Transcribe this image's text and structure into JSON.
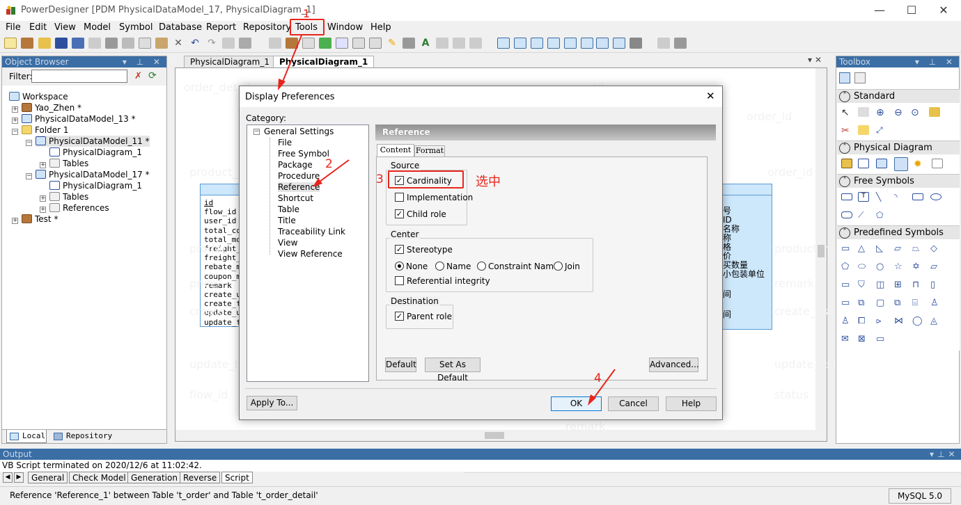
{
  "window": {
    "title": "PowerDesigner [PDM PhysicalDataModel_17, PhysicalDiagram_1]",
    "minimize": "—",
    "maximize": "☐",
    "close": "✕",
    "app_icon": "powerdesigner-icon"
  },
  "menu": [
    "File",
    "Edit",
    "View",
    "Model",
    "Symbol",
    "Database",
    "Report",
    "Repository",
    "Tools",
    "Window",
    "Help"
  ],
  "object_browser": {
    "title": "Object Browser",
    "filter_label": "Filter:",
    "filter_value": "",
    "caption_buttons": "▾ ⊥ ✕",
    "tree": [
      "Workspace",
      "Yao_Zhen *",
      "PhysicalDataModel_13 *",
      "Folder 1",
      "PhysicalDataModel_11 *",
      "PhysicalDiagram_1",
      "Tables",
      "PhysicalDataModel_17 *",
      "PhysicalDiagram_1",
      "Tables",
      "References",
      "Test *"
    ],
    "tabs": [
      "Local",
      "Repository"
    ]
  },
  "doc_tabs": [
    "PhysicalDiagram_1",
    "PhysicalDiagram_1"
  ],
  "canvas": {
    "left_table_columns": [
      "id",
      "flow_id",
      "user_id",
      "total_cou",
      "total_mor",
      "freight_m",
      "freight_v",
      "rebate_mc",
      "coupon_mc",
      "remark",
      "create_us",
      "create_ti",
      "update_us",
      "update_ti"
    ],
    "right_table_items": [
      "号",
      "ID",
      "名称",
      "称",
      "格",
      "价",
      "买数量",
      "小包装单位",
      "间",
      "间"
    ],
    "ghost_texts": [
      "order_detail",
      "status",
      "id",
      "order_id",
      "product_id",
      "order_id",
      "product_id",
      "product_name",
      "price",
      "remark",
      "create_time",
      "create_user",
      "update_time",
      "update_user",
      "flow_id",
      "status",
      "remark"
    ]
  },
  "toolbox": {
    "title": "Toolbox",
    "caption_buttons": "▾ ⊥ ✕",
    "sections": [
      "Standard",
      "Physical Diagram",
      "Free Symbols",
      "Predefined Symbols"
    ]
  },
  "dialog": {
    "title": "Display Preferences",
    "close": "✕",
    "category_label": "Category:",
    "categories": [
      "General Settings",
      "File",
      "Free Symbol",
      "Package",
      "Procedure",
      "Reference",
      "Shortcut",
      "Table",
      "Title",
      "Traceability Link",
      "View",
      "View Reference"
    ],
    "section_title": "Reference",
    "tabs": [
      "Content",
      "Format"
    ],
    "source": {
      "legend": "Source",
      "items": [
        {
          "label": "Cardinality",
          "checked": true
        },
        {
          "label": "Implementation",
          "checked": false
        },
        {
          "label": "Child role",
          "checked": true
        }
      ]
    },
    "center": {
      "legend": "Center",
      "stereotype": {
        "label": "Stereotype",
        "checked": true
      },
      "radios": [
        {
          "label": "None",
          "selected": true
        },
        {
          "label": "Name",
          "selected": false
        },
        {
          "label": "Constraint Name",
          "selected": false
        },
        {
          "label": "Join",
          "selected": false
        }
      ],
      "referential": {
        "label": "Referential integrity",
        "checked": false
      }
    },
    "destination": {
      "legend": "Destination",
      "items": [
        {
          "label": "Parent role",
          "checked": true
        }
      ]
    },
    "buttons": {
      "default": "Default",
      "set_as_default": "Set As Default",
      "advanced": "Advanced...",
      "apply_to": "Apply To...",
      "ok": "OK",
      "cancel": "Cancel",
      "help": "Help"
    }
  },
  "annotations": {
    "step1": "1",
    "step2": "2",
    "step3": "3",
    "step4": "4",
    "select_note": "选中",
    "color": "#e8251c"
  },
  "output": {
    "title": "Output",
    "log": "VB Script terminated on 2020/12/6 at 11:02:42.",
    "tabs": [
      "General",
      "Check Model",
      "Generation",
      "Reverse",
      "Script"
    ]
  },
  "status": {
    "message": "Reference 'Reference_1' between Table 't_order' and Table 't_order_detail'",
    "db": "MySQL 5.0"
  }
}
